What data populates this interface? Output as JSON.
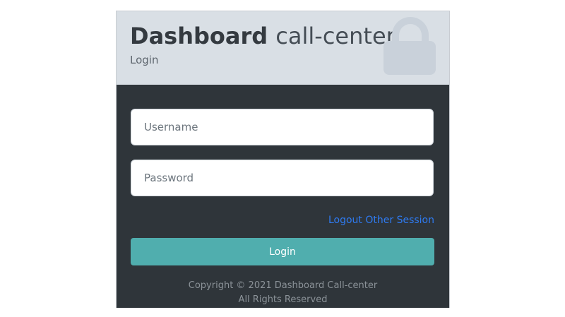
{
  "header": {
    "brand_bold": "Dashboard",
    "brand_light": "call-center",
    "subtitle": "Login",
    "icon": "lock-icon"
  },
  "form": {
    "username_placeholder": "Username",
    "password_placeholder": "Password",
    "logout_link": "Logout Other Session",
    "login_button": "Login"
  },
  "footer": {
    "copyright": "Copyright © 2021 Dashboard Call-center",
    "rights": "All Rights Reserved"
  },
  "colors": {
    "header_background": "#d9dfe5",
    "body_background": "#2f353a",
    "button": "#50aeae",
    "link": "#2f7bf2"
  }
}
